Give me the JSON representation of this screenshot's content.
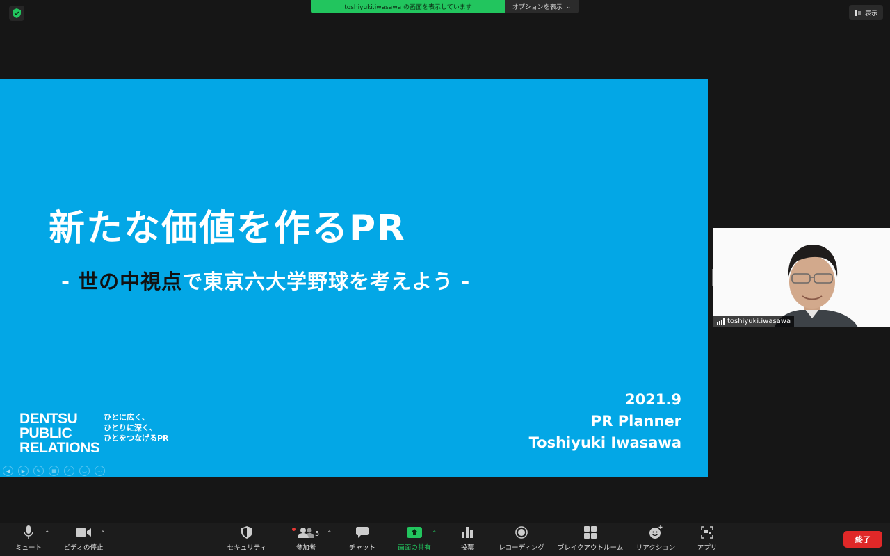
{
  "share_banner": {
    "text": "toshiyuki.iwasawa の画面を表示しています",
    "options_label": "オプションを表示"
  },
  "view_button": "表示",
  "slide": {
    "title": "新たな価値を作るPR",
    "subtitle_prefix": "- ",
    "subtitle_dark": "世の中視点",
    "subtitle_rest": "で東京六大学野球を考えよう -",
    "date": "2021.9",
    "role": "PR Planner",
    "author": "Toshiyuki Iwasawa",
    "logo_lines": [
      "DENTSU",
      "PUBLIC",
      "RELATIONS"
    ],
    "tagline": [
      "ひとに広く、",
      "ひとりに深く、",
      "ひとをつなげるPR"
    ]
  },
  "video": {
    "participant_name": "toshiyuki.iwasawa"
  },
  "toolbar": {
    "mute": "ミュート",
    "video_stop": "ビデオの停止",
    "security": "セキュリティ",
    "participants": "参加者",
    "participants_count": "5",
    "chat": "チャット",
    "share_screen": "画面の共有",
    "poll": "投票",
    "recording": "レコーディング",
    "breakout": "ブレイクアウトルーム",
    "reactions": "リアクション",
    "apps": "アプリ",
    "end": "終了"
  },
  "colors": {
    "slide_bg": "#03a7e6",
    "share_green": "#22c55e",
    "end_red": "#e02828"
  }
}
